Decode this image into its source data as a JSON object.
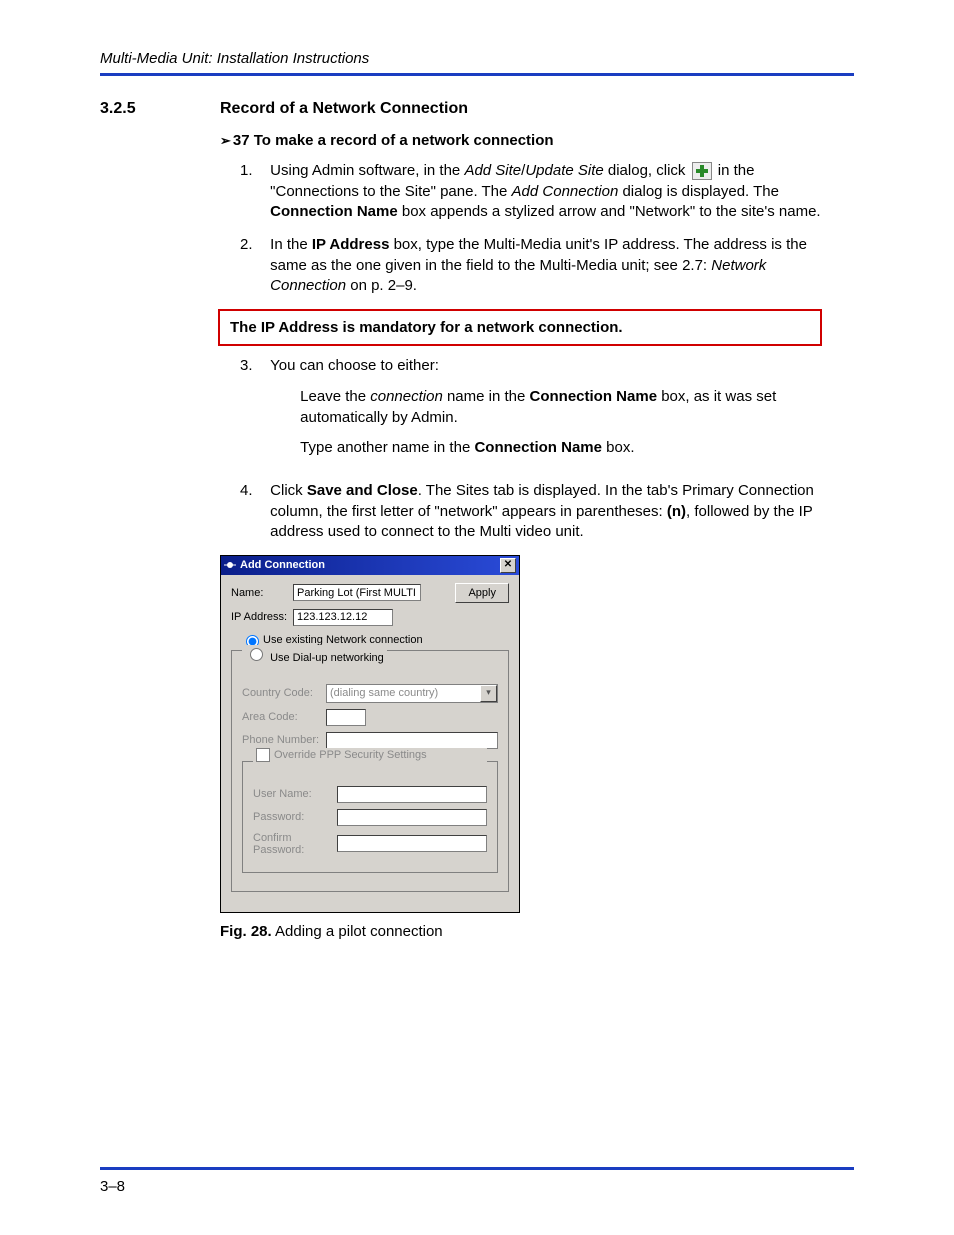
{
  "header": {
    "title": "Multi-Media Unit: Installation Instructions"
  },
  "section": {
    "number": "3.2.5",
    "title": "Record of a Network Connection"
  },
  "subhead": {
    "arrow": "➢",
    "text": "37 To make a record of a network connection"
  },
  "steps": {
    "s1": {
      "num": "1.",
      "t1": "Using Admin software, in the ",
      "i1": "Add Site",
      "t1b": "/",
      "i1b": "Update Site",
      "t2": " dialog, click ",
      "t3": " in the \"Connections to the Site\" pane. The ",
      "i2": "Add Connection",
      "t4": " dialog is displayed. The ",
      "b1": "Connection Name",
      "t5": " box appends a stylized arrow and \"Network\" to the site's name."
    },
    "s2": {
      "num": "2.",
      "t1": "In the ",
      "b1": "IP Address",
      "t2": " box, type the Multi-Media unit's IP address. The address is the same as the one given in the field to the Multi-Media unit; see 2.7: ",
      "i1": "Network Connection",
      "t3": " on p. 2–9."
    },
    "redbox": "The IP Address is mandatory for a network connection.",
    "s3": {
      "num": "3.",
      "t1": "You can choose to either:",
      "p1a": "Leave the ",
      "p1i": "connection",
      "p1b": " name in the ",
      "p1bold": "Connection Name",
      "p1c": " box, as it was set automatically by Admin.",
      "p2a": "Type another name in the ",
      "p2bold": "Connection Name",
      "p2b": " box."
    },
    "s4": {
      "num": "4.",
      "t1": "Click ",
      "b1": "Save and Close",
      "t2": ". The Sites tab is displayed. In the tab's Primary Connection column, the first letter of \"network\" appears in parentheses: ",
      "b2": "(n)",
      "t3": ", followed by the IP address used to connect to the Multi video unit."
    }
  },
  "dialog": {
    "title": "Add Connection",
    "close": "✕",
    "name_lbl": "Name:",
    "name_val": "Parking Lot (First MULTI Site)",
    "apply": "Apply",
    "ip_lbl": "IP Address:",
    "ip_val": "123.123.12.12",
    "radio_net": "Use existing Network connection",
    "radio_dial": "Use Dial-up networking",
    "cc_lbl": "Country Code:",
    "cc_val": "(dialing same country)",
    "ac_lbl": "Area Code:",
    "pn_lbl": "Phone Number:",
    "ovr_lbl": "Override PPP Security Settings",
    "un_lbl": "User Name:",
    "pw_lbl": "Password:",
    "cp_lbl": "Confirm Password:"
  },
  "figcap": {
    "bold": "Fig. 28.",
    "text": "  Adding a pilot connection"
  },
  "footer": {
    "page": "3–8"
  }
}
